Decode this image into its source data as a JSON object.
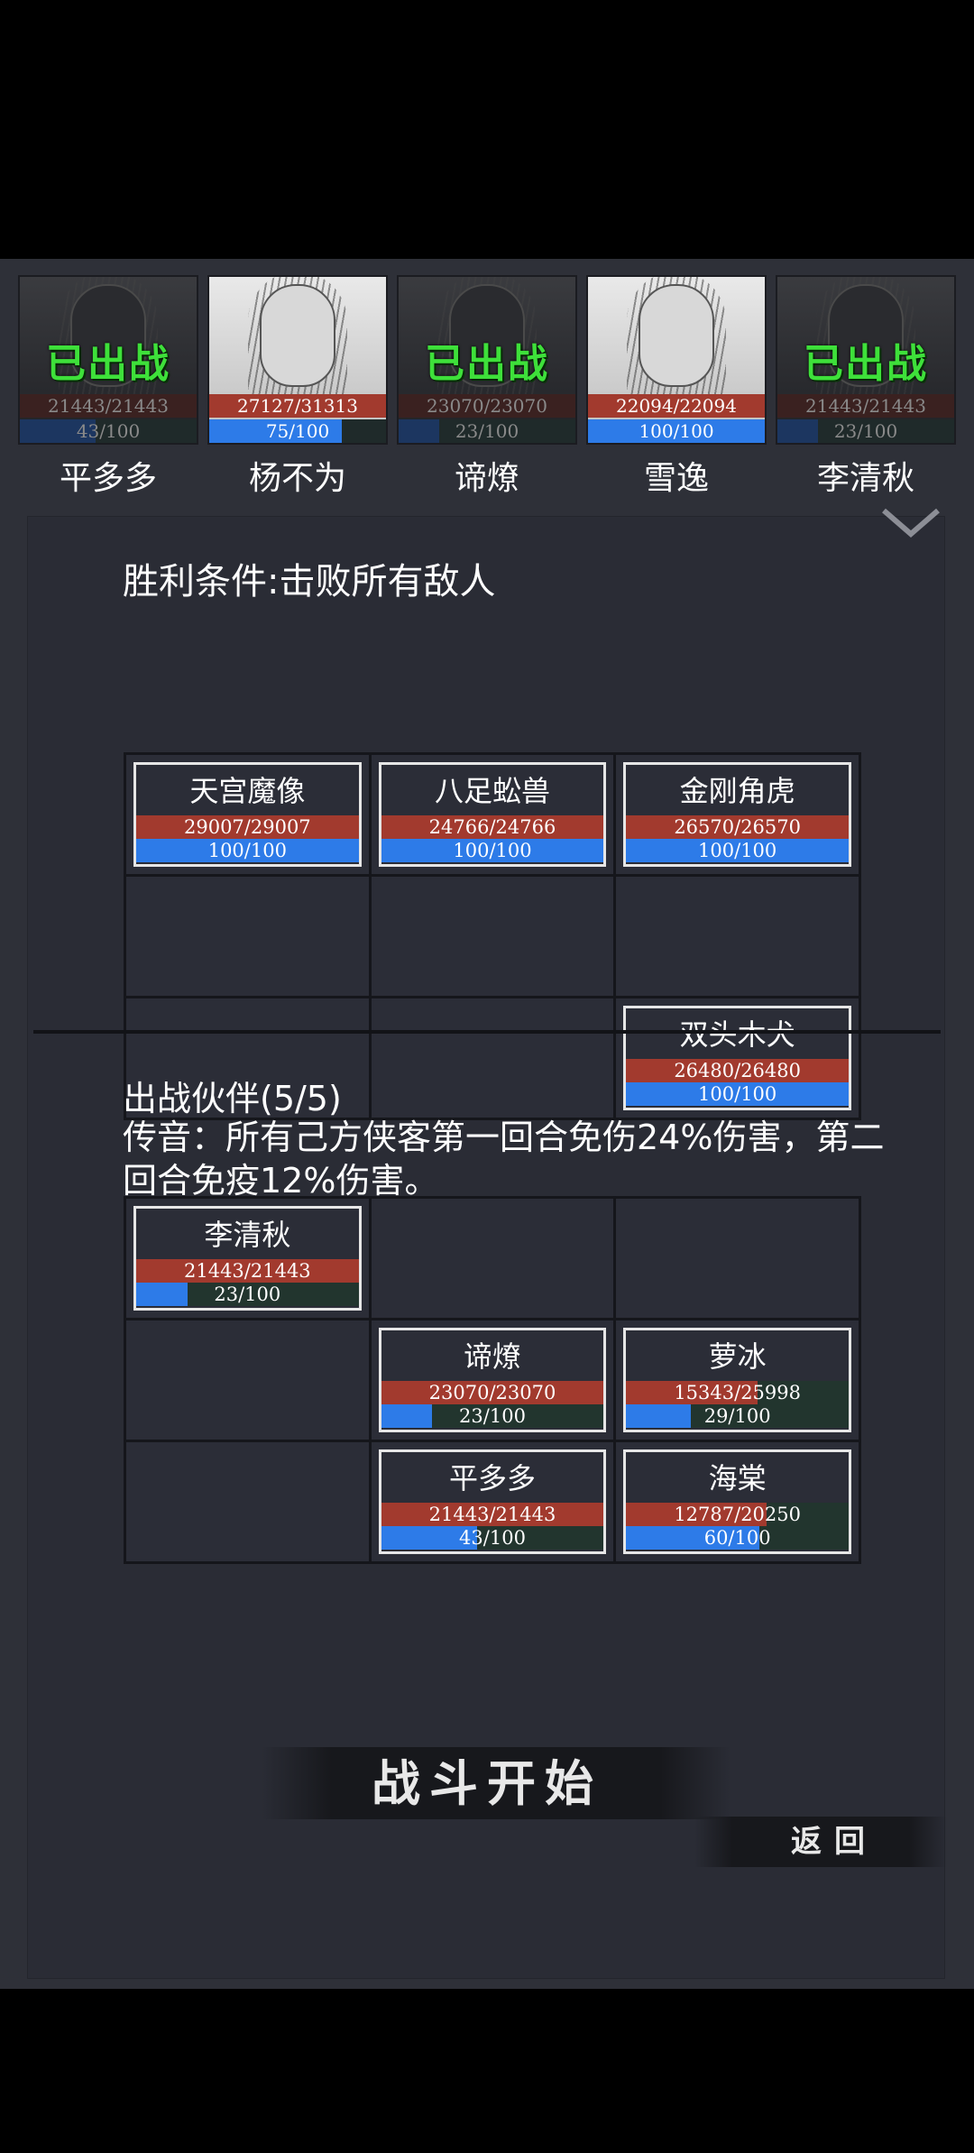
{
  "roster": [
    {
      "name": "平多多",
      "hp": "21443/21443",
      "mp": "43/100",
      "mp_pct": 0.43,
      "status": "已出战",
      "deployed": true
    },
    {
      "name": "杨不为",
      "hp": "27127/31313",
      "mp": "75/100",
      "mp_pct": 0.75,
      "status": "",
      "deployed": false
    },
    {
      "name": "谛燎",
      "hp": "23070/23070",
      "mp": "23/100",
      "mp_pct": 0.23,
      "status": "已出战",
      "deployed": true
    },
    {
      "name": "雪逸",
      "hp": "22094/22094",
      "mp": "100/100",
      "mp_pct": 1.0,
      "status": "",
      "deployed": false
    },
    {
      "name": "李清秋",
      "hp": "21443/21443",
      "mp": "23/100",
      "mp_pct": 0.23,
      "status": "已出战",
      "deployed": true
    }
  ],
  "victory_condition": "胜利条件:击败所有敌人",
  "enemy_grid": [
    {
      "name": "天宫魔像",
      "hp": "29007/29007",
      "hp_pct": 1.0,
      "mp": "100/100",
      "mp_pct": 1.0
    },
    {
      "name": "八足蚣兽",
      "hp": "24766/24766",
      "hp_pct": 1.0,
      "mp": "100/100",
      "mp_pct": 1.0
    },
    {
      "name": "金刚角虎",
      "hp": "26570/26570",
      "hp_pct": 1.0,
      "mp": "100/100",
      "mp_pct": 1.0
    },
    null,
    null,
    null,
    null,
    null,
    {
      "name": "双头木犬",
      "hp": "26480/26480",
      "hp_pct": 1.0,
      "mp": "100/100",
      "mp_pct": 1.0
    }
  ],
  "partners_title": "出战伙伴(5/5)",
  "passive_text": "传音：所有己方侠客第一回合免伤24%伤害，第二回合免疫12%伤害。",
  "ally_grid": [
    {
      "name": "李清秋",
      "hp": "21443/21443",
      "hp_pct": 1.0,
      "mp": "23/100",
      "mp_pct": 0.23
    },
    null,
    null,
    null,
    {
      "name": "谛燎",
      "hp": "23070/23070",
      "hp_pct": 1.0,
      "mp": "23/100",
      "mp_pct": 0.23
    },
    {
      "name": "萝冰",
      "hp": "15343/25998",
      "hp_pct": 0.59,
      "mp": "29/100",
      "mp_pct": 0.29
    },
    null,
    {
      "name": "平多多",
      "hp": "21443/21443",
      "hp_pct": 1.0,
      "mp": "43/100",
      "mp_pct": 0.43
    },
    {
      "name": "海棠",
      "hp": "12787/20250",
      "hp_pct": 0.63,
      "mp": "60/100",
      "mp_pct": 0.6
    }
  ],
  "start_button": "战斗开始",
  "back_button": "返回",
  "colors": {
    "hp": "#a23a2e",
    "mp": "#2d7be8",
    "deployed": "#3ee03a",
    "panel": "#2a2c35"
  }
}
